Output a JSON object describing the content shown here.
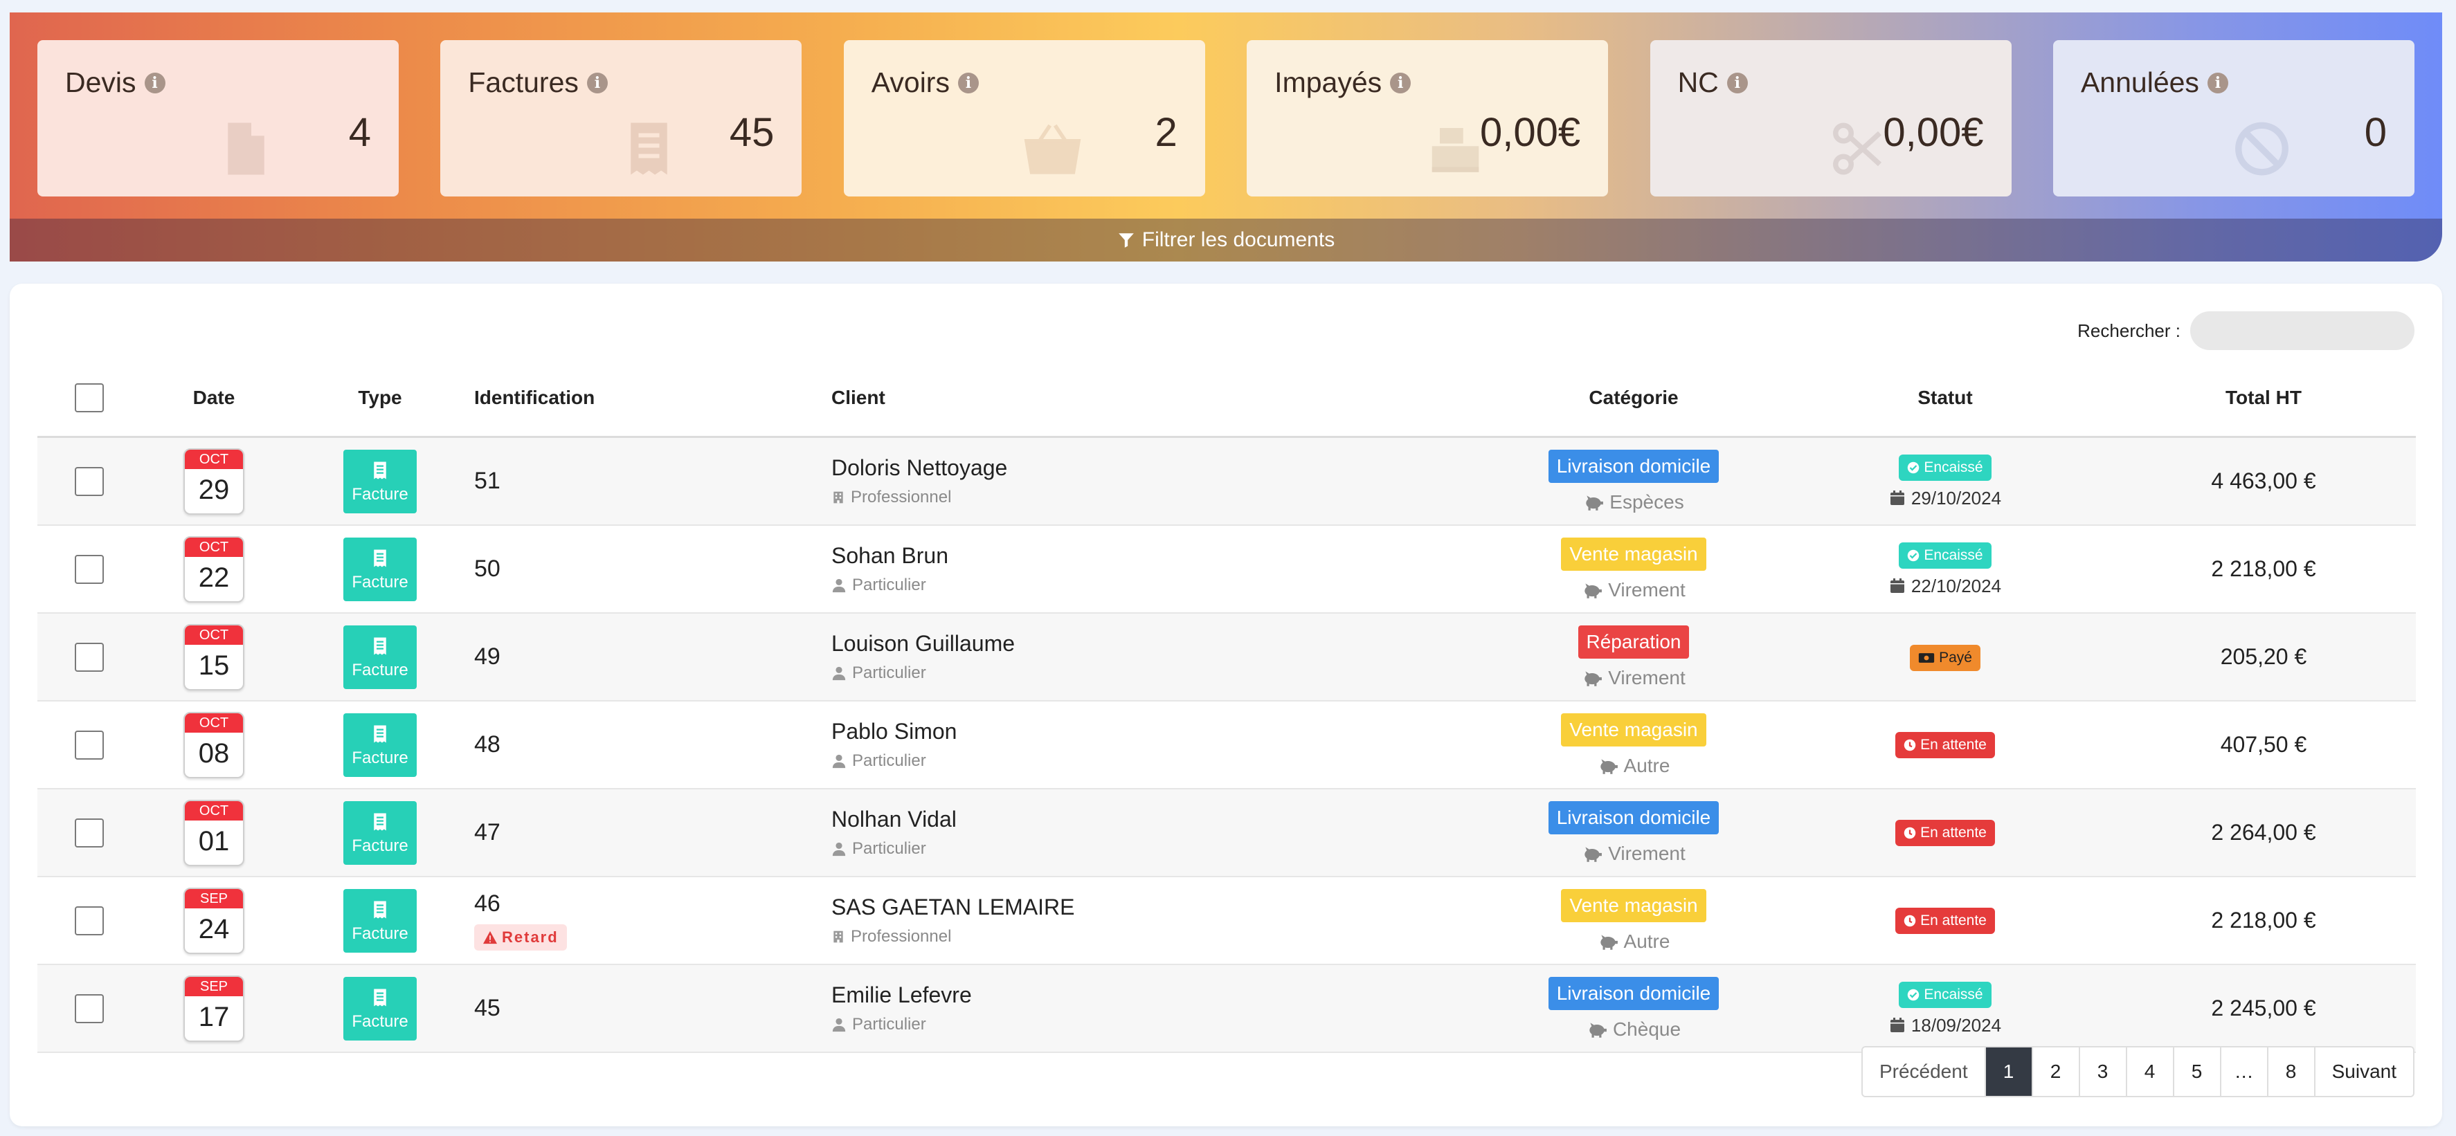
{
  "stats": [
    {
      "label": "Devis",
      "value": "4",
      "icon": "file-icon"
    },
    {
      "label": "Factures",
      "value": "45",
      "icon": "receipt-icon"
    },
    {
      "label": "Avoirs",
      "value": "2",
      "icon": "basket-icon"
    },
    {
      "label": "Impayés",
      "value": "0,00€",
      "icon": "cash-register-icon"
    },
    {
      "label": "NC",
      "value": "0,00€",
      "icon": "scissors-icon"
    },
    {
      "label": "Annulées",
      "value": "0",
      "icon": "ban-icon"
    }
  ],
  "filter": {
    "label": "Filtrer les documents"
  },
  "search": {
    "label": "Rechercher :",
    "value": ""
  },
  "table": {
    "headers": {
      "date": "Date",
      "type": "Type",
      "identification": "Identification",
      "client": "Client",
      "categorie": "Catégorie",
      "statut": "Statut",
      "total": "Total HT"
    },
    "rows": [
      {
        "month": "OCT",
        "day": "29",
        "type": "Facture",
        "id": "51",
        "retard": "",
        "client": "Doloris Nettoyage",
        "client_type": "Professionnel",
        "client_icon": "building-icon",
        "category": "Livraison domicile",
        "category_color": "#3b8ee8",
        "payment": "Espèces",
        "status": "Encaissé",
        "status_color": "#2ed5c0",
        "status_date": "29/10/2024",
        "total": "4 463,00 €"
      },
      {
        "month": "OCT",
        "day": "22",
        "type": "Facture",
        "id": "50",
        "retard": "",
        "client": "Sohan Brun",
        "client_type": "Particulier",
        "client_icon": "user-icon",
        "category": "Vente magasin",
        "category_color": "#f9cf3a",
        "payment": "Virement",
        "status": "Encaissé",
        "status_color": "#2ed5c0",
        "status_date": "22/10/2024",
        "total": "2 218,00 €"
      },
      {
        "month": "OCT",
        "day": "15",
        "type": "Facture",
        "id": "49",
        "retard": "",
        "client": "Louison Guillaume",
        "client_type": "Particulier",
        "client_icon": "user-icon",
        "category": "Réparation",
        "category_color": "#ea4444",
        "payment": "Virement",
        "status": "Payé",
        "status_color": "#f08a2c",
        "status_date": "",
        "total": "205,20 €"
      },
      {
        "month": "OCT",
        "day": "08",
        "type": "Facture",
        "id": "48",
        "retard": "",
        "client": "Pablo Simon",
        "client_type": "Particulier",
        "client_icon": "user-icon",
        "category": "Vente magasin",
        "category_color": "#f9cf3a",
        "payment": "Autre",
        "status": "En attente",
        "status_color": "#e53b3b",
        "status_date": "",
        "total": "407,50 €"
      },
      {
        "month": "OCT",
        "day": "01",
        "type": "Facture",
        "id": "47",
        "retard": "",
        "client": "Nolhan Vidal",
        "client_type": "Particulier",
        "client_icon": "user-icon",
        "category": "Livraison domicile",
        "category_color": "#3b8ee8",
        "payment": "Virement",
        "status": "En attente",
        "status_color": "#e53b3b",
        "status_date": "",
        "total": "2 264,00 €"
      },
      {
        "month": "SEP",
        "day": "24",
        "type": "Facture",
        "id": "46",
        "retard": "Retard",
        "client": "SAS GAETAN LEMAIRE",
        "client_type": "Professionnel",
        "client_icon": "building-icon",
        "category": "Vente magasin",
        "category_color": "#f9cf3a",
        "payment": "Autre",
        "status": "En attente",
        "status_color": "#e53b3b",
        "status_date": "",
        "total": "2 218,00 €"
      },
      {
        "month": "SEP",
        "day": "17",
        "type": "Facture",
        "id": "45",
        "retard": "",
        "client": "Emilie Lefevre",
        "client_type": "Particulier",
        "client_icon": "user-icon",
        "category": "Livraison domicile",
        "category_color": "#3b8ee8",
        "payment": "Chèque",
        "status": "Encaissé",
        "status_color": "#2ed5c0",
        "status_date": "18/09/2024",
        "total": "2 245,00 €"
      }
    ]
  },
  "pagination": {
    "prev": "Précédent",
    "pages": [
      "1",
      "2",
      "3",
      "4",
      "5",
      "…",
      "8"
    ],
    "active": "1",
    "next": "Suivant"
  },
  "colors": {
    "card_tints": [
      "#fbe3dc",
      "#fbe6d8",
      "#fdefd9",
      "#fbf0dd",
      "#efe9e8",
      "#e2e6f5"
    ]
  }
}
